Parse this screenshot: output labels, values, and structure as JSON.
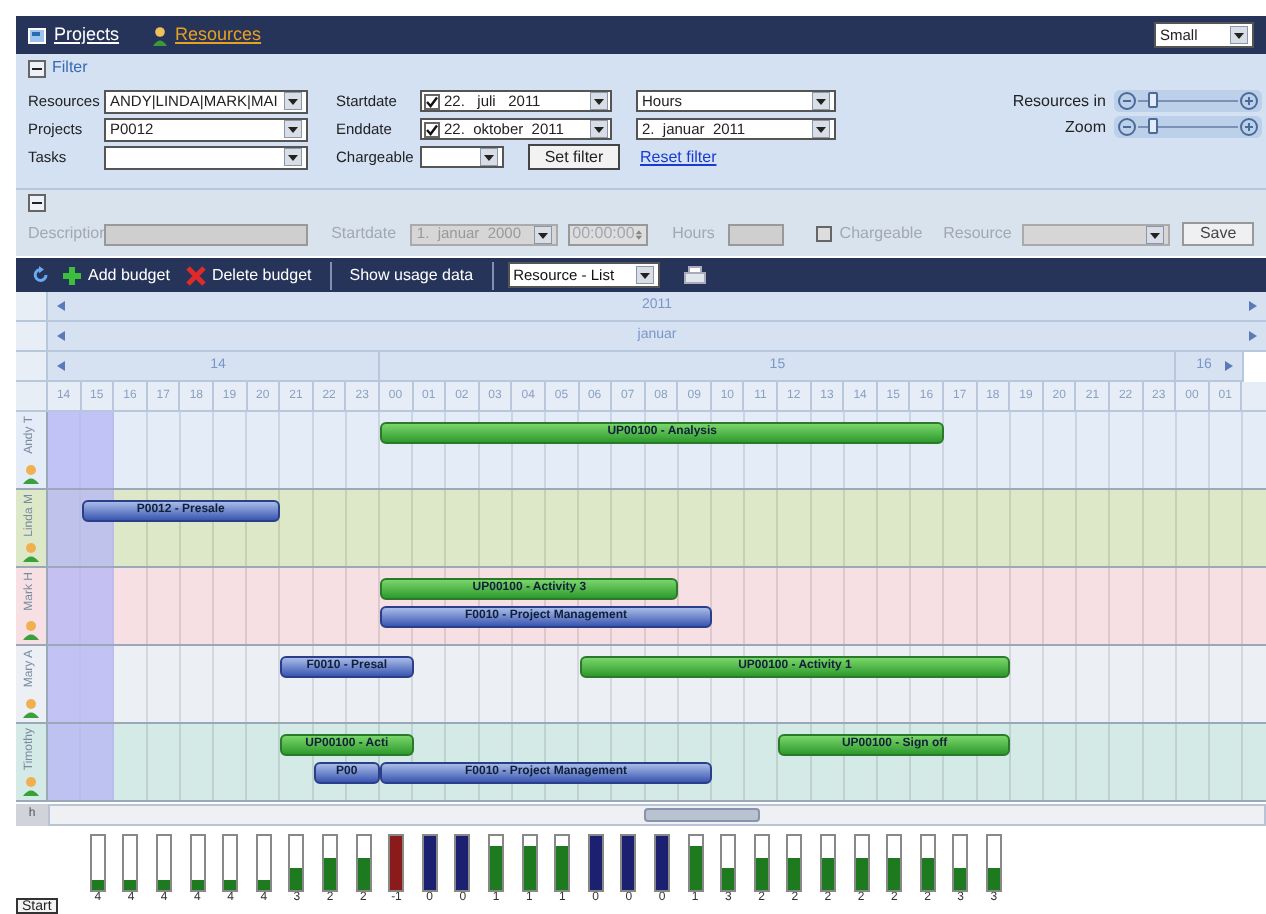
{
  "nav": {
    "tabs": [
      {
        "label": "Projects",
        "selected": false
      },
      {
        "label": "Resources",
        "selected": true
      }
    ],
    "size": "Small"
  },
  "filter": {
    "title": "Filter",
    "fields": [
      {
        "label": "Resources",
        "value": "ANDY|LINDA|MARK|MAI"
      },
      {
        "label": "Projects",
        "value": "P0012"
      },
      {
        "label": "Tasks"
      }
    ],
    "dates": [
      {
        "label": "Startdate",
        "checked": true,
        "value": "22.   juli   2011",
        "unit": "Hours"
      },
      {
        "label": "Enddate",
        "checked": true,
        "value": "22.  oktober  2011",
        "unit": "2.  januar  2011"
      }
    ],
    "chargeable": {
      "label": "Chargeable"
    },
    "set_button": "Set filter",
    "reset_link": "Reset filter",
    "sliders": [
      {
        "label": "Resources in",
        "level": 0.1
      },
      {
        "label": "Zoom",
        "level": 0.1
      }
    ]
  },
  "editor": {
    "disabled": true,
    "description_label": "Description",
    "startdate_label": "Startdate",
    "startdate": "1.  januar  2000",
    "time": "00:00:00",
    "hours_label": "Hours",
    "chargeable": {
      "label": "Chargeable",
      "checked": false
    },
    "resource_label": "Resource",
    "save": "Save"
  },
  "toolbar": {
    "buttons": [
      {
        "label": "Add budget",
        "kind": "add"
      },
      {
        "label": "Delete budget",
        "kind": "delete"
      },
      {
        "label": "Show usage data",
        "kind": "plain"
      }
    ],
    "view": "Resource - List"
  },
  "timeline": {
    "year": "2011",
    "month": "januar",
    "days": [
      "14",
      "15",
      "16"
    ],
    "hours": [
      "14",
      "15",
      "16",
      "17",
      "18",
      "19",
      "20",
      "21",
      "22",
      "23",
      "00",
      "01",
      "02",
      "03",
      "04",
      "05",
      "06",
      "07",
      "08",
      "09",
      "10",
      "11",
      "12",
      "13",
      "14",
      "15",
      "16",
      "17",
      "18",
      "19",
      "20",
      "21",
      "22",
      "23",
      "00",
      "01"
    ],
    "rows": [
      {
        "name": "Andy T",
        "color": "#e4ecf8",
        "lanes": [
          [
            {
              "label": "UP00100 - Analysis",
              "kind": "activity"
            }
          ]
        ]
      },
      {
        "name": "Linda M",
        "color": "#dce8c8",
        "lanes": [
          [
            {
              "label": "P0012 - Presale",
              "kind": "project"
            }
          ]
        ]
      },
      {
        "name": "Mark H",
        "color": "#f6e0e4",
        "lanes": [
          [
            {
              "label": "UP00100 - Activity 3",
              "kind": "activity"
            }
          ],
          [
            {
              "label": "F0010 - Project Management",
              "kind": "project"
            }
          ]
        ]
      },
      {
        "name": "Mary A",
        "color": "#eceff4",
        "lanes": [
          [
            {
              "label": "F0010 - Presal",
              "kind": "project"
            },
            {
              "label": "UP00100 - Activity 1",
              "kind": "activity"
            }
          ]
        ]
      },
      {
        "name": "Timothy",
        "color": "#d4eae6",
        "lanes": [
          [
            {
              "label": "UP00100 - Acti",
              "kind": "activity"
            },
            {
              "label": "UP00100 - Sign off",
              "kind": "activity"
            }
          ],
          [
            {
              "label": "P00",
              "kind": "project"
            },
            {
              "label": "F0010 - Project Management",
              "kind": "project"
            }
          ]
        ]
      }
    ]
  },
  "scroll_label": "h",
  "usage": [
    {
      "value": "4",
      "level": 0.2,
      "color": "#1e7a1e"
    },
    {
      "value": "4",
      "level": 0.2,
      "color": "#1e7a1e"
    },
    {
      "value": "4",
      "level": 0.2,
      "color": "#1e7a1e"
    },
    {
      "value": "4",
      "level": 0.2,
      "color": "#1e7a1e"
    },
    {
      "value": "4",
      "level": 0.2,
      "color": "#1e7a1e"
    },
    {
      "value": "4",
      "level": 0.2,
      "color": "#1e7a1e"
    },
    {
      "value": "3",
      "level": 0.4,
      "color": "#1e7a1e"
    },
    {
      "value": "2",
      "level": 0.6,
      "color": "#1e7a1e"
    },
    {
      "value": "2",
      "level": 0.6,
      "color": "#1e7a1e"
    },
    {
      "value": "-1",
      "level": 1,
      "color": "#8b1a1a"
    },
    {
      "value": "0",
      "level": 1,
      "color": "#1c2070"
    },
    {
      "value": "0",
      "level": 1,
      "color": "#1c2070"
    },
    {
      "value": "1",
      "level": 0.8,
      "color": "#1e7a1e"
    },
    {
      "value": "1",
      "level": 0.8,
      "color": "#1e7a1e"
    },
    {
      "value": "1",
      "level": 0.8,
      "color": "#1e7a1e"
    },
    {
      "value": "0",
      "level": 1,
      "color": "#1c2070"
    },
    {
      "value": "0",
      "level": 1,
      "color": "#1c2070"
    },
    {
      "value": "0",
      "level": 1,
      "color": "#1c2070"
    },
    {
      "value": "1",
      "level": 0.8,
      "color": "#1e7a1e"
    },
    {
      "value": "3",
      "level": 0.4,
      "color": "#1e7a1e"
    },
    {
      "value": "2",
      "level": 0.6,
      "color": "#1e7a1e"
    },
    {
      "value": "2",
      "level": 0.6,
      "color": "#1e7a1e"
    },
    {
      "value": "2",
      "level": 0.6,
      "color": "#1e7a1e"
    },
    {
      "value": "2",
      "level": 0.6,
      "color": "#1e7a1e"
    },
    {
      "value": "2",
      "level": 0.6,
      "color": "#1e7a1e"
    },
    {
      "value": "2",
      "level": 0.6,
      "color": "#1e7a1e"
    },
    {
      "value": "3",
      "level": 0.4,
      "color": "#1e7a1e"
    },
    {
      "value": "3",
      "level": 0.4,
      "color": "#1e7a1e"
    }
  ],
  "taskbar": {
    "start": "Start"
  }
}
